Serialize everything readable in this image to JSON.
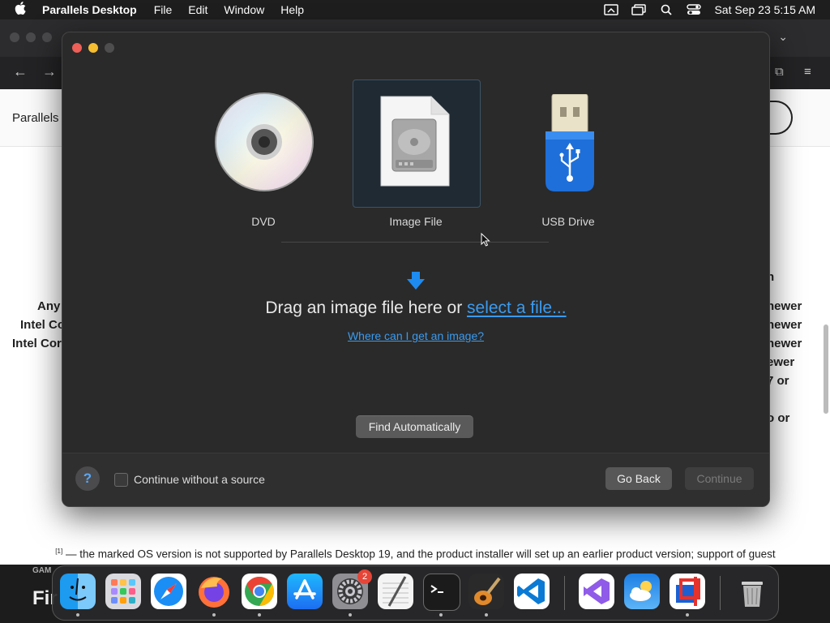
{
  "menubar": {
    "app_name": "Parallels Desktop",
    "menus": [
      "File",
      "Edit",
      "Window",
      "Help"
    ],
    "clock": "Sat Sep 23  5:15 AM"
  },
  "browser": {
    "site_title": "Parallels",
    "left_fragments": [
      "Any",
      "Intel Co",
      "Intel Cor"
    ],
    "right_fragments": [
      "n",
      "newer",
      "newer",
      "newer",
      "ewer",
      "7 or",
      "o or"
    ],
    "footnote_mark": "[1]",
    "footnote": "— the marked OS version is not supported by Parallels Desktop 19, and the product installer will set up an earlier product version; support of guest operating systems can be limited. It is recommended to update macOS if possible.",
    "bottom_label": "GAM",
    "bottom_big": "Fir"
  },
  "dialog": {
    "sources": [
      {
        "label": "DVD",
        "selected": false
      },
      {
        "label": "Image File",
        "selected": true
      },
      {
        "label": "USB Drive",
        "selected": false
      }
    ],
    "drag_prefix": "Drag an image file here or ",
    "select_link": "select a file...",
    "help_link": "Where can I get an image?",
    "find_button": "Find Automatically",
    "help_button": "?",
    "no_source_label": "Continue without a source",
    "go_back": "Go Back",
    "continue": "Continue"
  },
  "dock": {
    "apps": [
      "Finder",
      "Launchpad",
      "Safari",
      "Firefox",
      "Chrome",
      "App Store",
      "System Settings",
      "TextEdit",
      "Terminal",
      "GarageBand",
      "VS Code",
      "Visual Studio",
      "Weather",
      "Parallels Desktop",
      "Trash"
    ],
    "settings_badge": "2"
  },
  "colors": {
    "accent": "#3a9bf0",
    "dialog_bg": "#2a2a2a"
  }
}
